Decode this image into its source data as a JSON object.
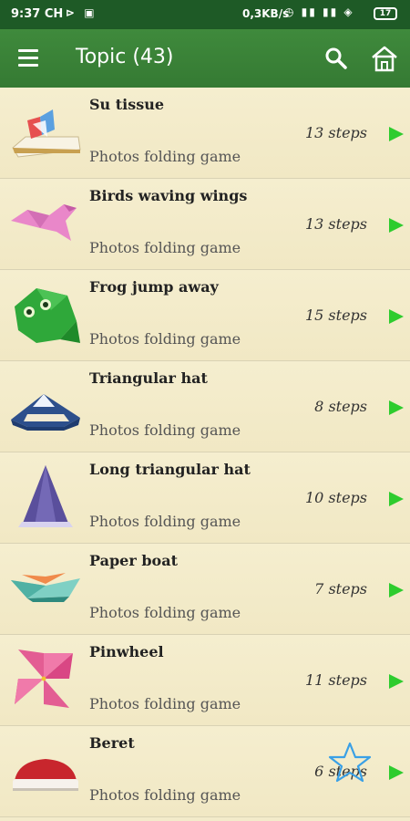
{
  "status": {
    "time": "9:37 CH",
    "icons": "⊳ ▣",
    "speed": "0,3KB/s",
    "right": "◷ ▮▮ ▮▮ ◈",
    "battery": "17"
  },
  "appbar": {
    "title": "Topic (43)"
  },
  "items": [
    {
      "name": "Su tissue",
      "sub": "Photos folding game",
      "steps": "13 steps"
    },
    {
      "name": "Birds waving wings",
      "sub": "Photos folding game",
      "steps": "13 steps"
    },
    {
      "name": "Frog jump away",
      "sub": "Photos folding game",
      "steps": "15 steps"
    },
    {
      "name": "Triangular hat",
      "sub": "Photos folding game",
      "steps": "8 steps"
    },
    {
      "name": "Long triangular hat",
      "sub": "Photos folding game",
      "steps": "10 steps"
    },
    {
      "name": "Paper boat",
      "sub": "Photos folding game",
      "steps": "7 steps"
    },
    {
      "name": "Pinwheel",
      "sub": "Photos folding game",
      "steps": "11 steps"
    },
    {
      "name": "Beret",
      "sub": "Photos folding game",
      "steps": "6 steps"
    }
  ],
  "colors": {
    "appbar": "#3f8a3c",
    "statusbar": "#1e5a26",
    "arrow": "#2ecc2e",
    "background": "#f3ebca"
  }
}
